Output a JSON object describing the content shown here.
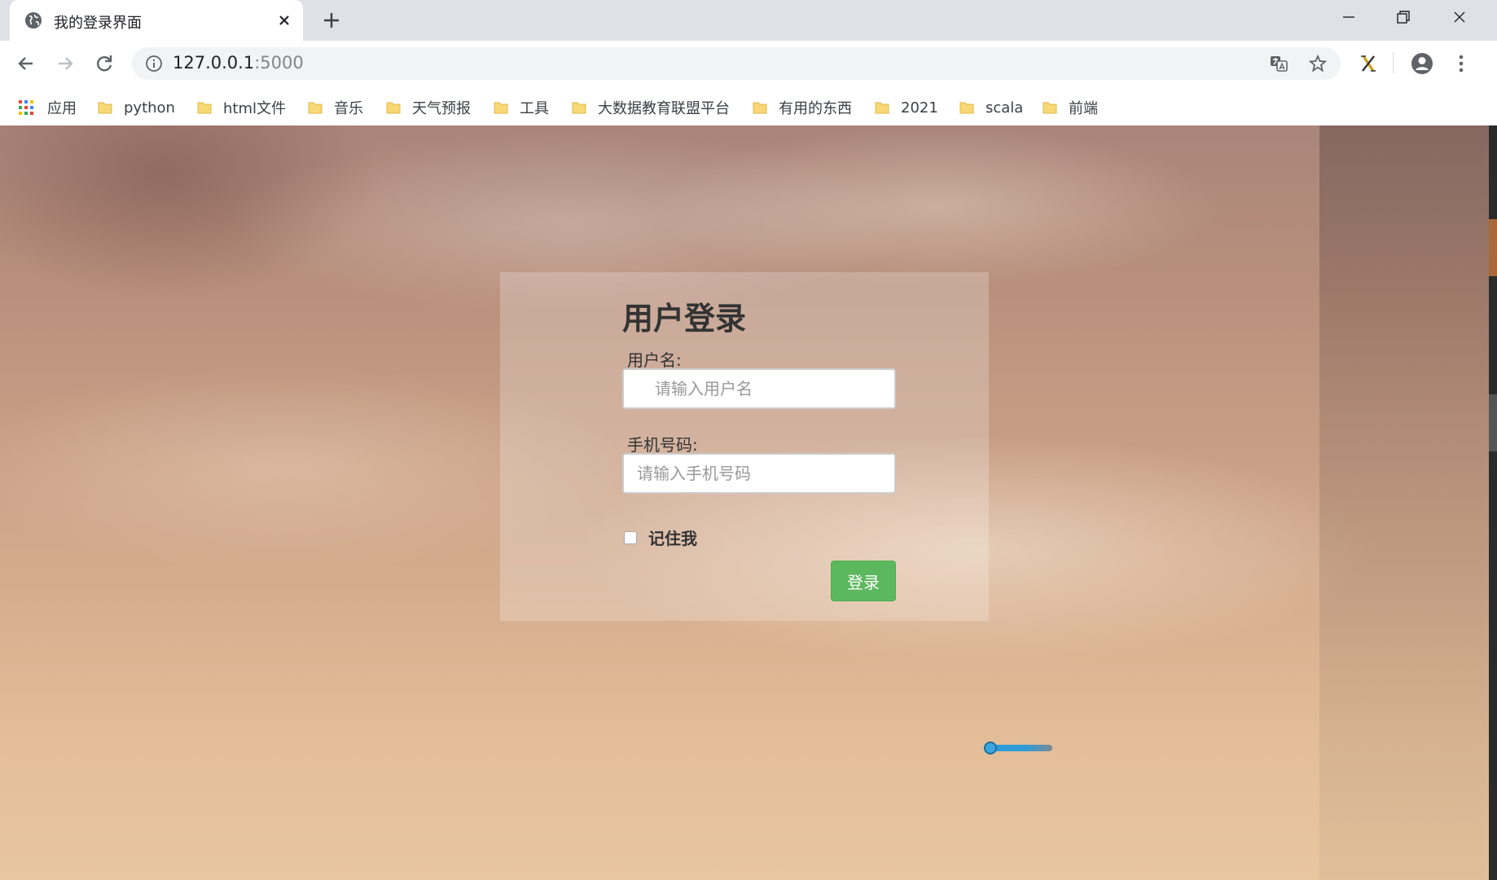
{
  "browser": {
    "tab_title": "我的登录界面",
    "url_host": "127.0.0.1",
    "url_port": ":5000",
    "icons": {
      "favicon": "globe-icon",
      "close": "close-icon",
      "new_tab": "plus-icon",
      "back": "back-arrow-icon",
      "forward": "forward-arrow-icon",
      "reload": "reload-icon",
      "info": "info-icon",
      "translate": "translate-icon",
      "bookmark": "star-icon",
      "extension": "extension-icon",
      "profile": "profile-icon",
      "menu": "kebab-menu-icon"
    }
  },
  "bookmarks": [
    {
      "label": "应用"
    },
    {
      "label": "python"
    },
    {
      "label": "html文件"
    },
    {
      "label": "音乐"
    },
    {
      "label": "天气预报"
    },
    {
      "label": "工具"
    },
    {
      "label": "大数据教育联盟平台"
    },
    {
      "label": "有用的东西"
    },
    {
      "label": "2021"
    },
    {
      "label": "scala"
    },
    {
      "label": "前端"
    }
  ],
  "login": {
    "title": "用户登录",
    "username_label": "用户名:",
    "username_placeholder": "请输入用户名",
    "phone_label": "手机号码:",
    "phone_placeholder": "请输入手机号码",
    "remember_label": "记住我",
    "submit_label": "登录"
  },
  "colors": {
    "primary_button": "#5cb85c",
    "folder_icon": "#f8d775"
  }
}
